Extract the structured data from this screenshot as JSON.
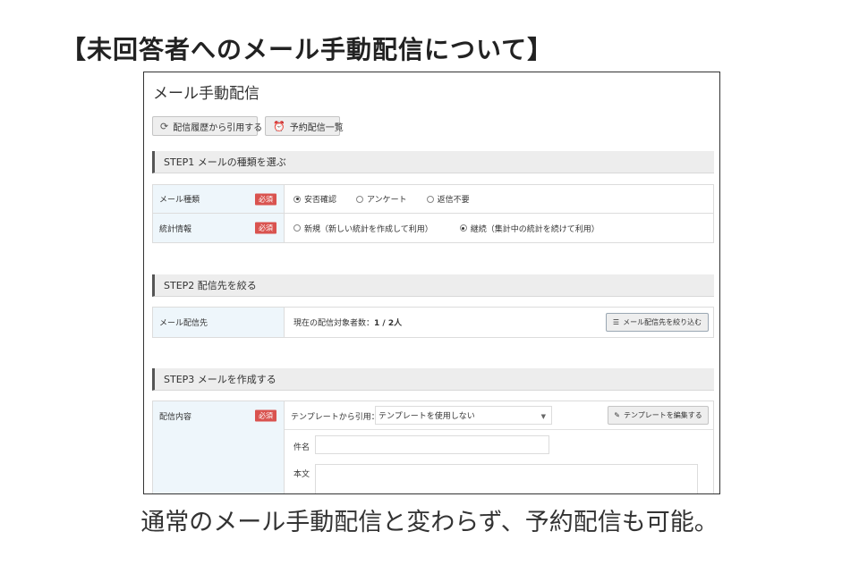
{
  "slide": {
    "title": "【未回答者へのメール手動配信について】",
    "caption": "通常のメール手動配信と変わらず、予約配信も可能。"
  },
  "window": {
    "title": "メール手動配信",
    "buttons": {
      "history": "配信履歴から引用する",
      "schedule": "予約配信一覧"
    }
  },
  "step1": {
    "heading": "STEP1 メールの種類を選ぶ",
    "rows": [
      {
        "label": "メール種類",
        "required": "必須",
        "options": [
          "安否確認",
          "アンケート",
          "返信不要"
        ],
        "selected": 0
      },
      {
        "label": "統計情報",
        "required": "必須",
        "options": [
          "新規（新しい統計を作成して利用）",
          "継続（集計中の統計を続けて利用）"
        ],
        "selected": 1
      }
    ]
  },
  "step2": {
    "heading": "STEP2 配信先を絞る",
    "label": "メール配信先",
    "current_prefix": "現在の配信対象者数：",
    "current_value": "1 / 2人",
    "filter_button": "メール配信先を絞り込む"
  },
  "step3": {
    "heading": "STEP3 メールを作成する",
    "label": "配信内容",
    "required": "必須",
    "template_label": "テンプレートから引用：",
    "template_value": "テンプレートを使用しない",
    "edit_button": "テンプレートを編集する",
    "subject_label": "件名",
    "body_label": "本文"
  },
  "colors": {
    "required_badge": "#d9534f",
    "label_cell_bg": "#eef6fb",
    "step_header_bg": "#ededed"
  }
}
